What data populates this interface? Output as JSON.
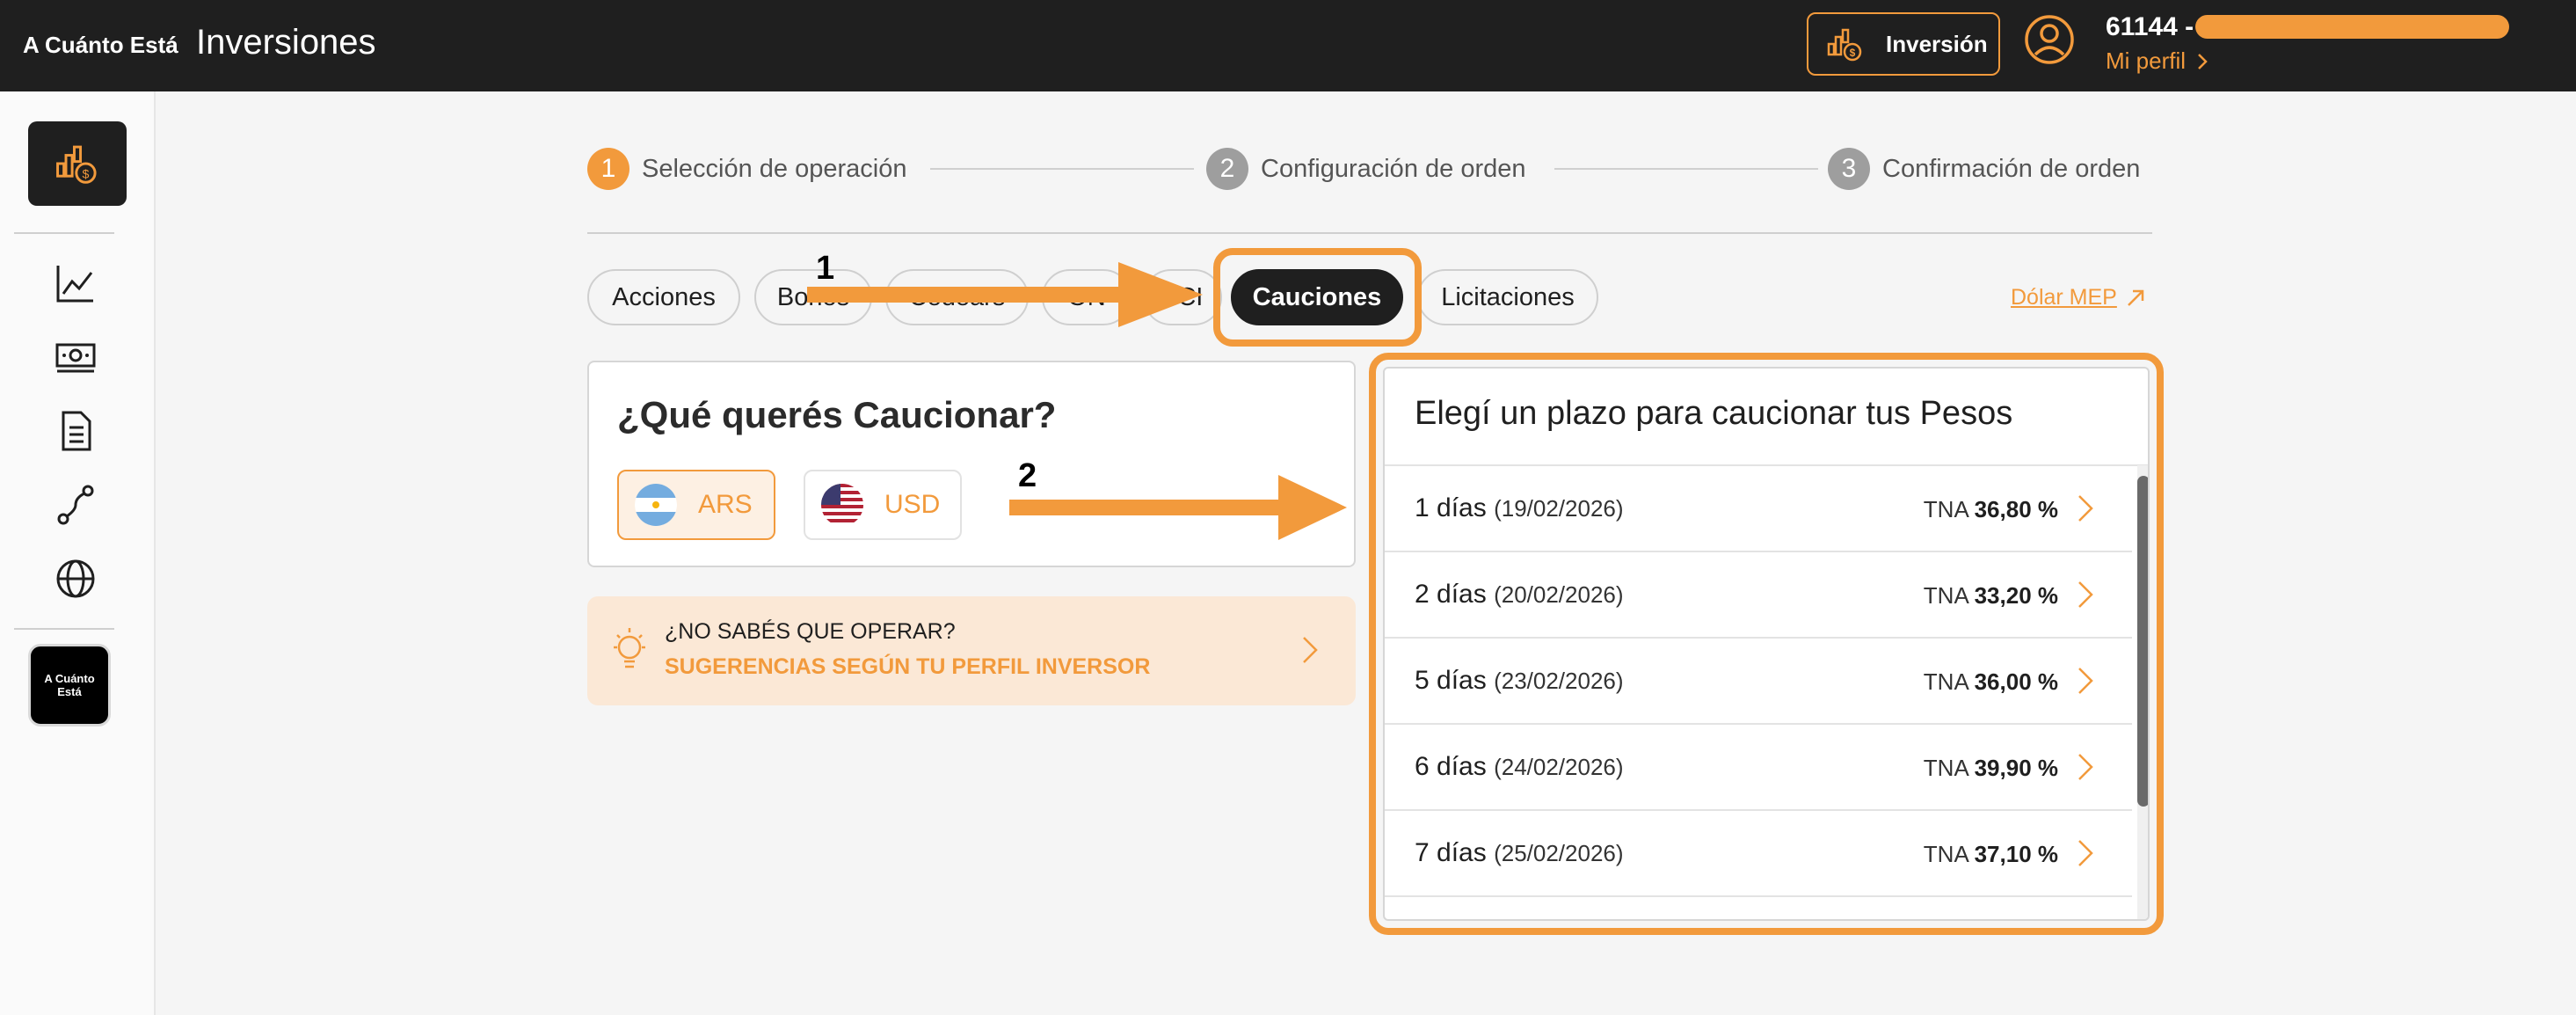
{
  "header": {
    "brand_small": "A Cuánto Está",
    "title": "Inversiones",
    "inversion_button": "Inversión",
    "user_id": "61144 -",
    "profile_link": "Mi perfil"
  },
  "sidebar": {
    "logo_text": "A Cuánto Está",
    "icons": [
      "investment-icon",
      "chart-line-icon",
      "cash-icon",
      "document-icon",
      "route-icon",
      "globe-icon"
    ]
  },
  "stepper": {
    "steps": [
      {
        "num": "1",
        "label": "Selección de operación"
      },
      {
        "num": "2",
        "label": "Configuración de orden"
      },
      {
        "num": "3",
        "label": "Confirmación de orden"
      }
    ]
  },
  "tabs": {
    "items": [
      {
        "label": "Acciones"
      },
      {
        "label": "Bonos"
      },
      {
        "label": "Cedears"
      },
      {
        "label": "ON"
      },
      {
        "label": "FCI"
      },
      {
        "label": "Cauciones"
      },
      {
        "label": "Licitaciones"
      }
    ],
    "active": "Cauciones",
    "dolar_link": "Dólar MEP"
  },
  "currency_card": {
    "title": "¿Qué querés Caucionar?",
    "options": [
      {
        "code": "ARS",
        "selected": true
      },
      {
        "code": "USD",
        "selected": false
      }
    ]
  },
  "suggestion": {
    "question": "¿NO SABÉS QUE OPERAR?",
    "link": "SUGERENCIAS SEGÚN TU PERFIL INVERSOR"
  },
  "plazos_card": {
    "title": "Elegí un plazo para caucionar tus Pesos",
    "items": [
      {
        "days": "1 días",
        "date": "(19/02/2026)",
        "tna_label": "TNA",
        "tna_value": "36,80 %"
      },
      {
        "days": "2 días",
        "date": "(20/02/2026)",
        "tna_label": "TNA",
        "tna_value": "33,20 %"
      },
      {
        "days": "5 días",
        "date": "(23/02/2026)",
        "tna_label": "TNA",
        "tna_value": "36,00 %"
      },
      {
        "days": "6 días",
        "date": "(24/02/2026)",
        "tna_label": "TNA",
        "tna_value": "39,90 %"
      },
      {
        "days": "7 días",
        "date": "(25/02/2026)",
        "tna_label": "TNA",
        "tna_value": "37,10 %"
      }
    ]
  },
  "annotations": {
    "one": "1",
    "two": "2"
  },
  "colors": {
    "accent": "#f29a3c",
    "dark": "#1f1f1f"
  }
}
